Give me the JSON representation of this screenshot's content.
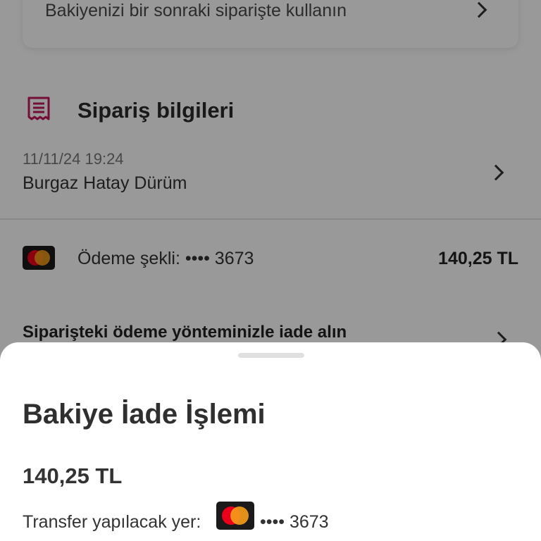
{
  "balance_card": {
    "text": "Bakiyenizi bir sonraki siparişte kullanın"
  },
  "order_section": {
    "title": "Sipariş bilgileri",
    "date": "11/11/24 19:24",
    "restaurant": "Burgaz Hatay Dürüm"
  },
  "payment": {
    "label": "Ödeme şekli: •••• 3673",
    "amount": "140,25 TL"
  },
  "refund_method": {
    "text": "Siparişteki ödeme yönteminizle iade alın"
  },
  "sheet": {
    "title": "Bakiye İade İşlemi",
    "amount": "140,25 TL",
    "transfer_label": "Transfer yapılacak yer:",
    "transfer_card": "•••• 3673"
  },
  "colors": {
    "brand": "#c2185b",
    "mastercard_red": "#eb001b",
    "mastercard_yellow": "#f79e1b"
  },
  "icons": [
    "receipt-icon",
    "chevron-right-icon",
    "mastercard-icon"
  ]
}
